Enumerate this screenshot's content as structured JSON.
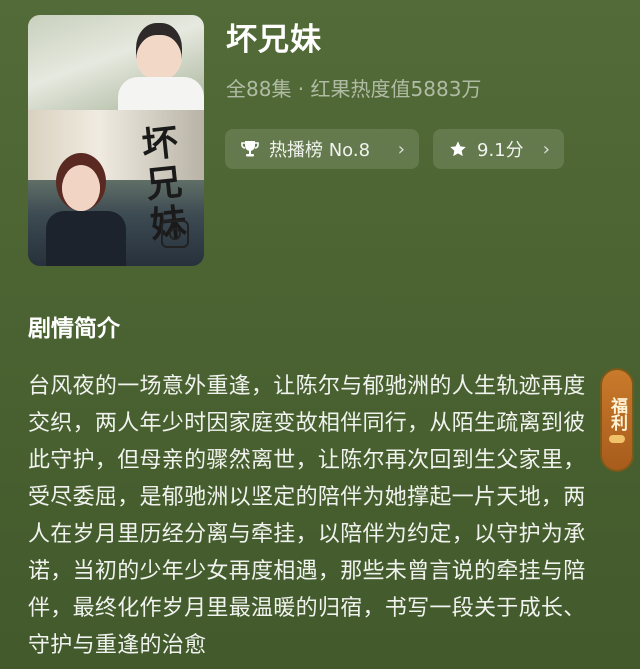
{
  "drama": {
    "title": "坏兄妹",
    "meta": "全88集 · 红果热度值5883万",
    "rank_label": "热播榜 No.8",
    "rating_label": "9.1分",
    "poster_title_art": "坏兄妹",
    "poster_icon": "camera-logo-icon"
  },
  "synopsis": {
    "heading": "剧情简介",
    "body": "台风夜的一场意外重逢，让陈尔与郁驰洲的人生轨迹再度交织，两人年少时因家庭变故相伴同行，从陌生疏离到彼此守护，但母亲的骤然离世，让陈尔再次回到生父家里，受尽委屈，是郁驰洲以坚定的陪伴为她撑起一片天地，两人在岁月里历经分离与牵挂，以陪伴为约定，以守护为承诺，当初的少年少女再度相遇，那些未曾言说的牵挂与陪伴，最终化作岁月里最温暖的归宿，书写一段关于成长、守护与重逢的治愈"
  },
  "side_badge": {
    "label": "福利"
  },
  "icons": {
    "rank": "trophy-icon",
    "rating": "star-icon",
    "chevron": "chevron-right-icon"
  },
  "colors": {
    "background": "#4d6533",
    "chip": "rgba(255,255,255,0.12)",
    "badge": "#b86a24"
  }
}
